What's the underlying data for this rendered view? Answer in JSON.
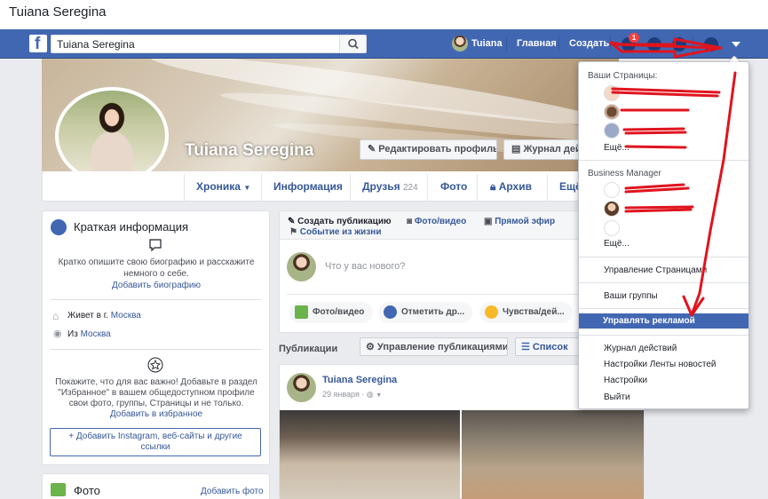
{
  "window": {
    "title": "Tuiana Seregina"
  },
  "topbar": {
    "search_value": "Tuiana Seregina",
    "user_name": "Tuiana",
    "home_label": "Главная",
    "create_label": "Создать",
    "notif_count": "1"
  },
  "profile": {
    "name": "Tuiana Seregina",
    "edit_profile_label": "Редактировать профиль",
    "activity_log_label": "Журнал дейс"
  },
  "tabs": [
    {
      "label": "Хроника"
    },
    {
      "label": "Информация"
    },
    {
      "label": "Друзья",
      "count": "224"
    },
    {
      "label": "Фото"
    },
    {
      "label": "Архив"
    },
    {
      "label": "Ещё"
    }
  ],
  "intro": {
    "title": "Краткая информация",
    "bio_prompt": "Кратко опишите свою биографию и расскажите немного о себе.",
    "add_bio": "Добавить биографию",
    "lives_prefix": "Живет в г.",
    "lives_city": "Москва",
    "from_prefix": "Из",
    "from_city": "Москва",
    "featured_prompt": "Покажите, что для вас важно! Добавьте в раздел \"Избранное\" в вашем общедоступном профиле свои фото, группы, Страницы и не только.",
    "add_featured": "Добавить в избранное",
    "add_links": "+ Добавить Instagram, веб-сайты и другие ссылки"
  },
  "photos_card": {
    "title": "Фото",
    "add_photo": "Добавить фото"
  },
  "composer": {
    "tab_create": "Создать публикацию",
    "tab_photo": "Фото/видео",
    "tab_live": "Прямой эфир",
    "tab_life_event": "Событие из жизни",
    "placeholder": "Что у вас нового?",
    "btn_photo": "Фото/видео",
    "btn_tag": "Отметить др...",
    "btn_feeling": "Чувства/дей..."
  },
  "publications": {
    "label": "Публикации",
    "manage_label": "Управление публикациями",
    "list_label": "Список"
  },
  "post": {
    "author": "Tuiana Seregina",
    "date": "29 января"
  },
  "dropdown": {
    "your_pages_header": "Ваши Страницы:",
    "more_pages": "Ещё...",
    "business_header": "Business Manager",
    "more_business": "Ещё...",
    "manage_pages": "Управление Страницами",
    "your_groups": "Ваши группы",
    "manage_ads": "Управлять рекламой",
    "activity_log": "Журнал действий",
    "news_feed_settings": "Настройки Ленты новостей",
    "settings": "Настройки",
    "logout": "Выйти"
  },
  "colors": {
    "brand_blue": "#4267b2",
    "link_blue": "#365899",
    "annotation_red": "#e0141e",
    "highlight": "#4267b2"
  }
}
